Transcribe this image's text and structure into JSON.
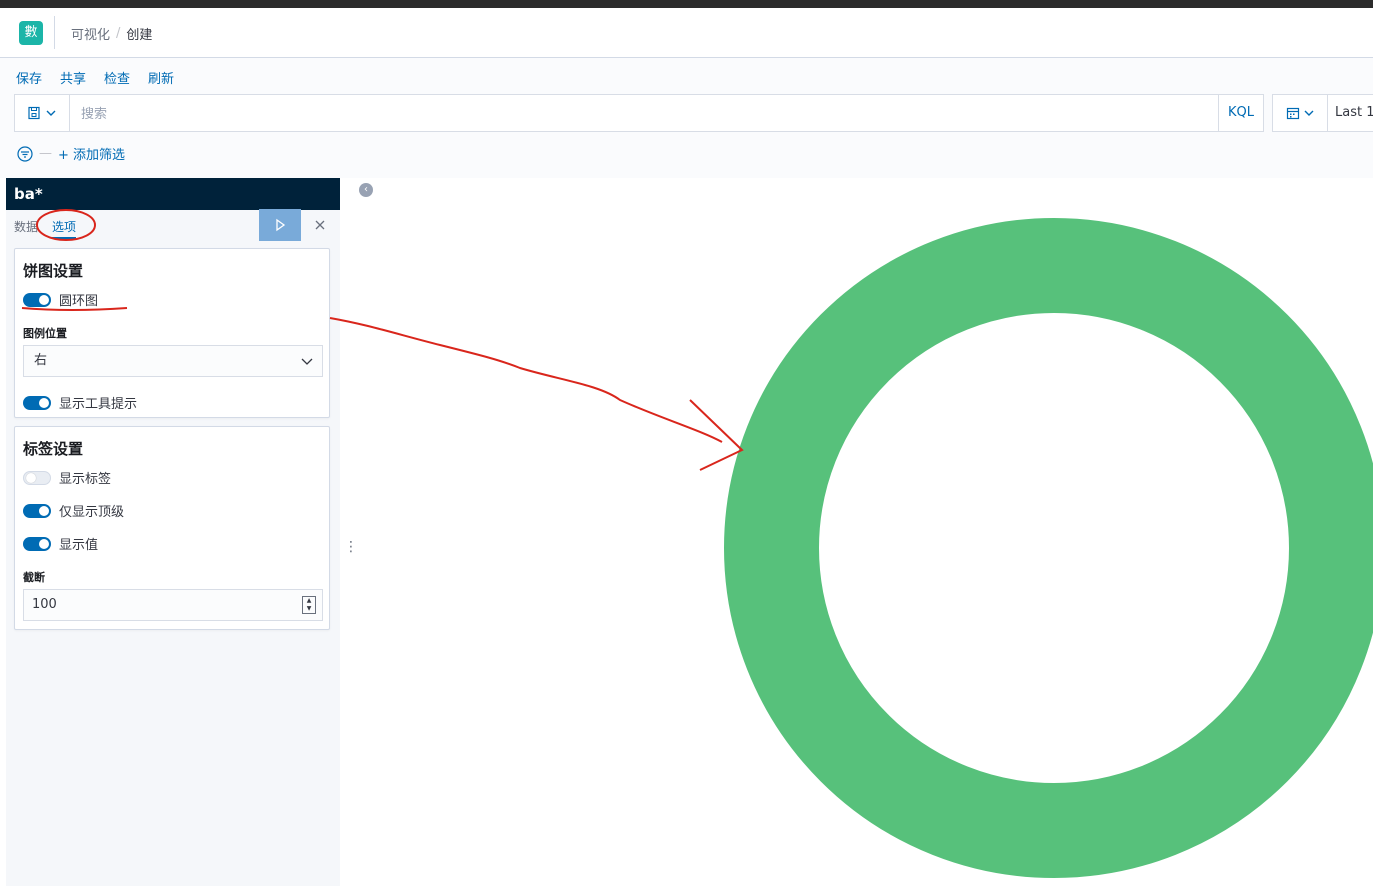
{
  "header": {
    "logo_text": "數",
    "breadcrumb": [
      "可视化",
      "创建"
    ]
  },
  "menu": [
    "保存",
    "共享",
    "检查",
    "刷新"
  ],
  "query": {
    "placeholder": "搜索",
    "language": "KQL"
  },
  "datepicker": {
    "text": "Last 1"
  },
  "filter": {
    "add_label": "+ 添加筛选"
  },
  "sidebar": {
    "index_pattern": "ba*",
    "tabs": [
      "数据",
      "选项"
    ],
    "active_tab": "选项",
    "pie_settings": {
      "title": "饼图设置",
      "donut_label": "圆环图",
      "donut_on": true,
      "legend_position_label": "图例位置",
      "legend_position_value": "右",
      "tooltip_label": "显示工具提示",
      "tooltip_on": true
    },
    "label_settings": {
      "title": "标签设置",
      "show_labels": "显示标签",
      "show_labels_on": false,
      "top_level_only": "仅显示顶级",
      "top_level_only_on": true,
      "show_values": "显示值",
      "show_values_on": true,
      "truncate_label": "截断",
      "truncate_value": "100"
    }
  },
  "chart_data": {
    "type": "pie",
    "donut": true,
    "series": [
      {
        "values": [
          100
        ],
        "color": "#57c17b"
      }
    ]
  },
  "colors": {
    "accent": "#006bb4",
    "index_bar": "#00223a",
    "donut": "#57c17b",
    "annotation": "#d9261c"
  }
}
